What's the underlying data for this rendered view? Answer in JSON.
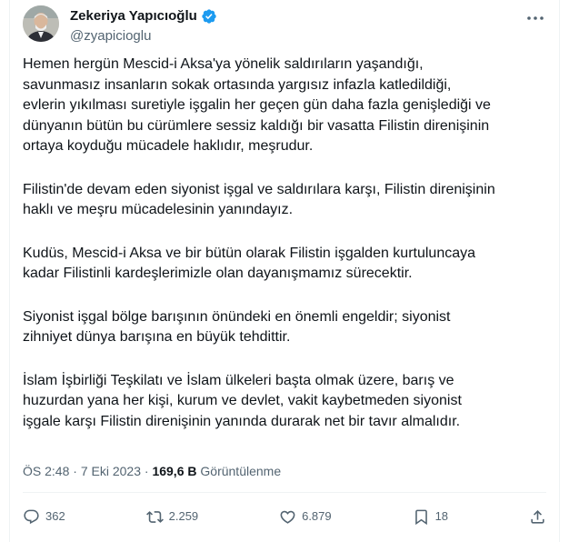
{
  "author": {
    "display_name": "Zekeriya Yapıcıoğlu",
    "handle": "@zyapicioglu",
    "verified": true
  },
  "tweet": {
    "paragraphs": [
      "Hemen hergün Mescid-i Aksa'ya yönelik saldırıların yaşandığı,\nsavunmasız insanların sokak ortasında yargısız infazla katledildiği,\nevlerin yıkılması suretiyle işgalin her geçen gün daha fazla genişlediği ve\ndünyanın bütün bu cürümlere sessiz kaldığı bir vasatta Filistin direnişinin\nortaya koyduğu mücadele haklıdır, meşrudur.",
      "Filistin'de devam eden siyonist işgal ve saldırılara karşı, Filistin direnişinin\nhaklı ve meşru mücadelesinin  yanındayız.",
      "Kudüs, Mescid-i Aksa ve bir bütün olarak Filistin işgalden kurtuluncaya\nkadar Filistinli kardeşlerimizle olan dayanışmamız sürecektir.",
      "Siyonist işgal bölge barışının önündeki en önemli engeldir; siyonist\nzihniyet dünya barışına en büyük tehdittir.",
      "İslam İşbirliği Teşkilatı ve İslam ülkeleri başta olmak üzere, barış ve\nhuzurdan yana her kişi, kurum ve devlet, vakit kaybetmeden siyonist\nişgale karşı Filistin direnişinin yanında durarak net bir tavır almalıdır."
    ],
    "time": "ÖS 2:48",
    "separator": "·",
    "date": "7 Eki 2023",
    "views_count": "169,6 B",
    "views_label": "Görüntülenme"
  },
  "actions": {
    "replies": "362",
    "reposts": "2.259",
    "likes": "6.879",
    "bookmarks": "18"
  },
  "colors": {
    "text": "#0f1419",
    "secondary": "#536471",
    "verified": "#1d9bf0",
    "divider": "#eff3f4"
  }
}
